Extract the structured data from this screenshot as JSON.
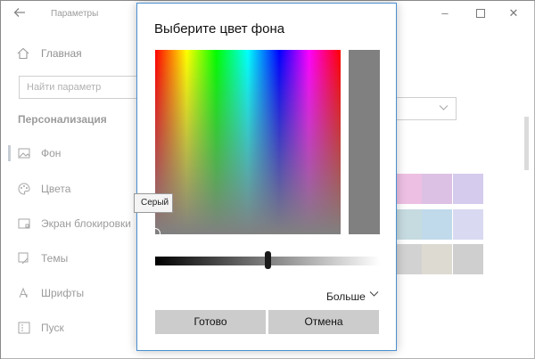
{
  "window": {
    "title": "Параметры",
    "back_icon": "back-arrow-icon",
    "controls": [
      "minimize-icon",
      "maximize-icon",
      "close-icon"
    ]
  },
  "sidebar": {
    "home_label": "Главная",
    "search_placeholder": "Найти параметр",
    "section_title": "Персонализация",
    "items": [
      {
        "label": "Фон",
        "icon": "image-icon",
        "active": true
      },
      {
        "label": "Цвета",
        "icon": "palette-icon",
        "active": false
      },
      {
        "label": "Экран блокировки",
        "icon": "lock-screen-icon",
        "active": false
      },
      {
        "label": "Темы",
        "icon": "brush-icon",
        "active": false
      },
      {
        "label": "Шрифты",
        "icon": "font-icon",
        "active": false
      },
      {
        "label": "Пуск",
        "icon": "start-icon",
        "active": false
      }
    ]
  },
  "swatch_colors": [
    "#e39fd5",
    "#c9a0d6",
    "#bfb0e3",
    "#a8c8d0",
    "#9ec6e0",
    "#c5c6ea",
    "#bbbbbb",
    "#cbc6ba",
    "#b5b5b5"
  ],
  "tooltip": {
    "text": "Серый"
  },
  "dialog": {
    "title": "Выберите цвет фона",
    "selected_color": "#808080",
    "brightness": 0.5,
    "more_label": "Больше",
    "ok_label": "Готово",
    "cancel_label": "Отмена"
  }
}
